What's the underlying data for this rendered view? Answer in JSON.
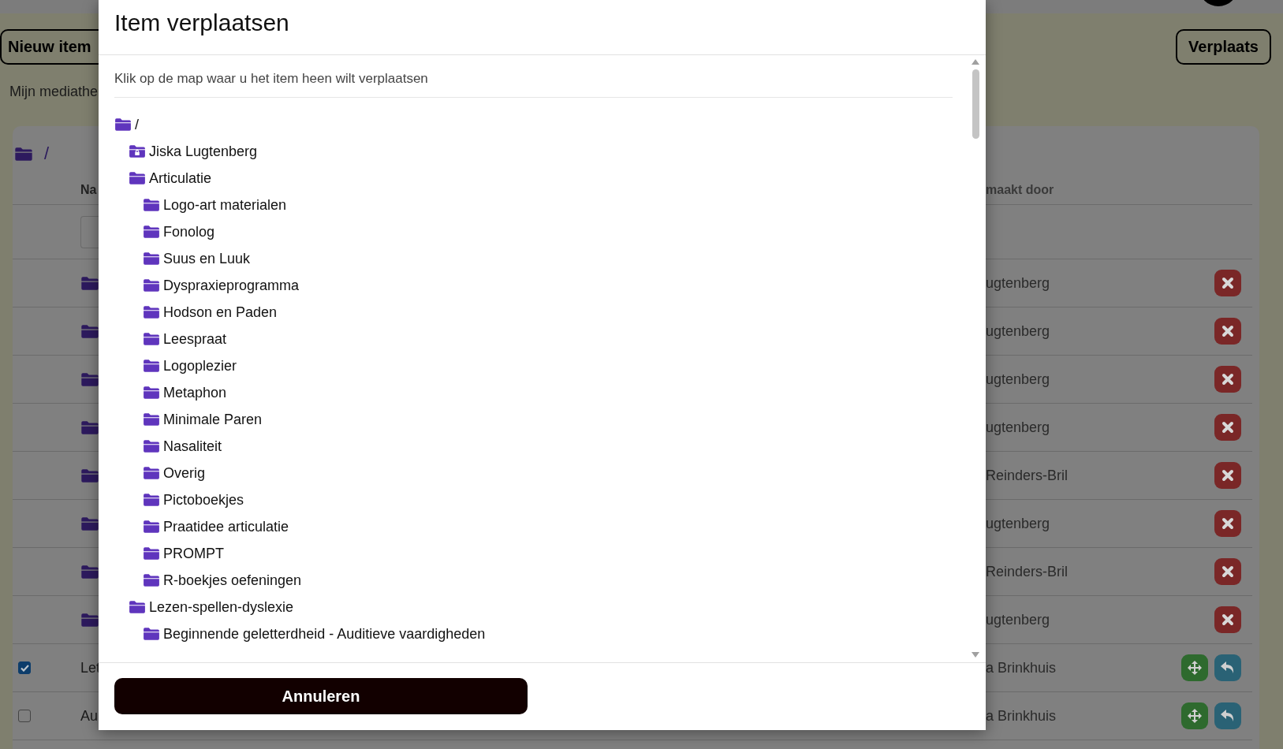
{
  "toolbar": {
    "new_button": "Nieuw item",
    "move_button": "Verplaats"
  },
  "section_label": "Mijn mediathe",
  "library": {
    "path": "/",
    "columns": [
      {
        "label": "Na"
      },
      {
        "label": "maakt door"
      }
    ],
    "rows": [
      {
        "kind": "folder",
        "creator": "ugtenberg"
      },
      {
        "kind": "folder",
        "creator": "ugtenberg"
      },
      {
        "kind": "folder",
        "creator": "ugtenberg"
      },
      {
        "kind": "folder",
        "creator": "ugtenberg"
      },
      {
        "kind": "folder",
        "creator": "Reinders-Bril"
      },
      {
        "kind": "folder",
        "creator": "ugtenberg"
      },
      {
        "kind": "folder",
        "creator": "Reinders-Bril"
      },
      {
        "kind": "folder",
        "creator": "ugtenberg"
      },
      {
        "kind": "item",
        "checked": true,
        "name": "Let",
        "creator": "a Brinkhuis"
      },
      {
        "kind": "item",
        "checked": false,
        "name": "Au",
        "creator": "a Brinkhuis"
      }
    ]
  },
  "dialog": {
    "title": "Item verplaatsen",
    "instruction": "Klik op de map waar u het item heen wilt verplaatsen",
    "tree": {
      "label": "/",
      "locked": false,
      "children": [
        {
          "label": "Jiska Lugtenberg",
          "locked": true
        },
        {
          "label": "Articulatie",
          "locked": false,
          "children": [
            {
              "label": "Logo-art materialen",
              "locked": false
            },
            {
              "label": "Fonolog",
              "locked": false
            },
            {
              "label": "Suus en Luuk",
              "locked": false
            },
            {
              "label": "Dyspraxieprogramma",
              "locked": false
            },
            {
              "label": "Hodson en Paden",
              "locked": false
            },
            {
              "label": "Leespraat",
              "locked": false
            },
            {
              "label": "Logoplezier",
              "locked": false
            },
            {
              "label": "Metaphon",
              "locked": false
            },
            {
              "label": "Minimale Paren",
              "locked": false
            },
            {
              "label": "Nasaliteit",
              "locked": false
            },
            {
              "label": "Overig",
              "locked": false
            },
            {
              "label": "Pictoboekjes",
              "locked": false
            },
            {
              "label": "Praatidee articulatie",
              "locked": false
            },
            {
              "label": "PROMPT",
              "locked": false
            },
            {
              "label": "R-boekjes oefeningen",
              "locked": false
            }
          ]
        },
        {
          "label": "Lezen-spellen-dyslexie",
          "locked": false,
          "children": [
            {
              "label": "Beginnende geletterdheid - Auditieve vaardigheden",
              "locked": false
            }
          ]
        }
      ]
    },
    "cancel_button": "Annuleren"
  }
}
